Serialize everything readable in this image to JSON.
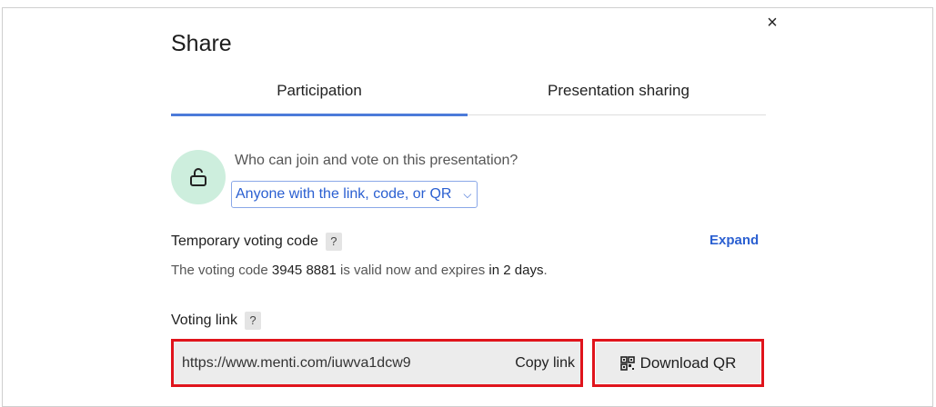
{
  "dialog": {
    "title": "Share",
    "close_label": "×"
  },
  "tabs": [
    {
      "label": "Participation",
      "active": true
    },
    {
      "label": "Presentation sharing",
      "active": false
    }
  ],
  "access": {
    "question": "Who can join and vote on this presentation?",
    "selected": "Anyone with the link, code, or QR",
    "chevron": "⌵"
  },
  "voting_code": {
    "title": "Temporary voting code",
    "help": "?",
    "expand_label": "Expand",
    "text_prefix": "The voting code ",
    "code": "3945 8881",
    "text_middle": " is valid now and expires ",
    "expiry": "in 2 days",
    "text_suffix": "."
  },
  "voting_link": {
    "title": "Voting link",
    "help": "?",
    "url": "https://www.menti.com/iuwva1dcw9",
    "copy_label": "Copy link",
    "download_qr_label": "Download QR"
  },
  "colors": {
    "accent": "#2a5fd1",
    "highlight": "#e0141c",
    "lock_bg": "#cdeedd"
  }
}
